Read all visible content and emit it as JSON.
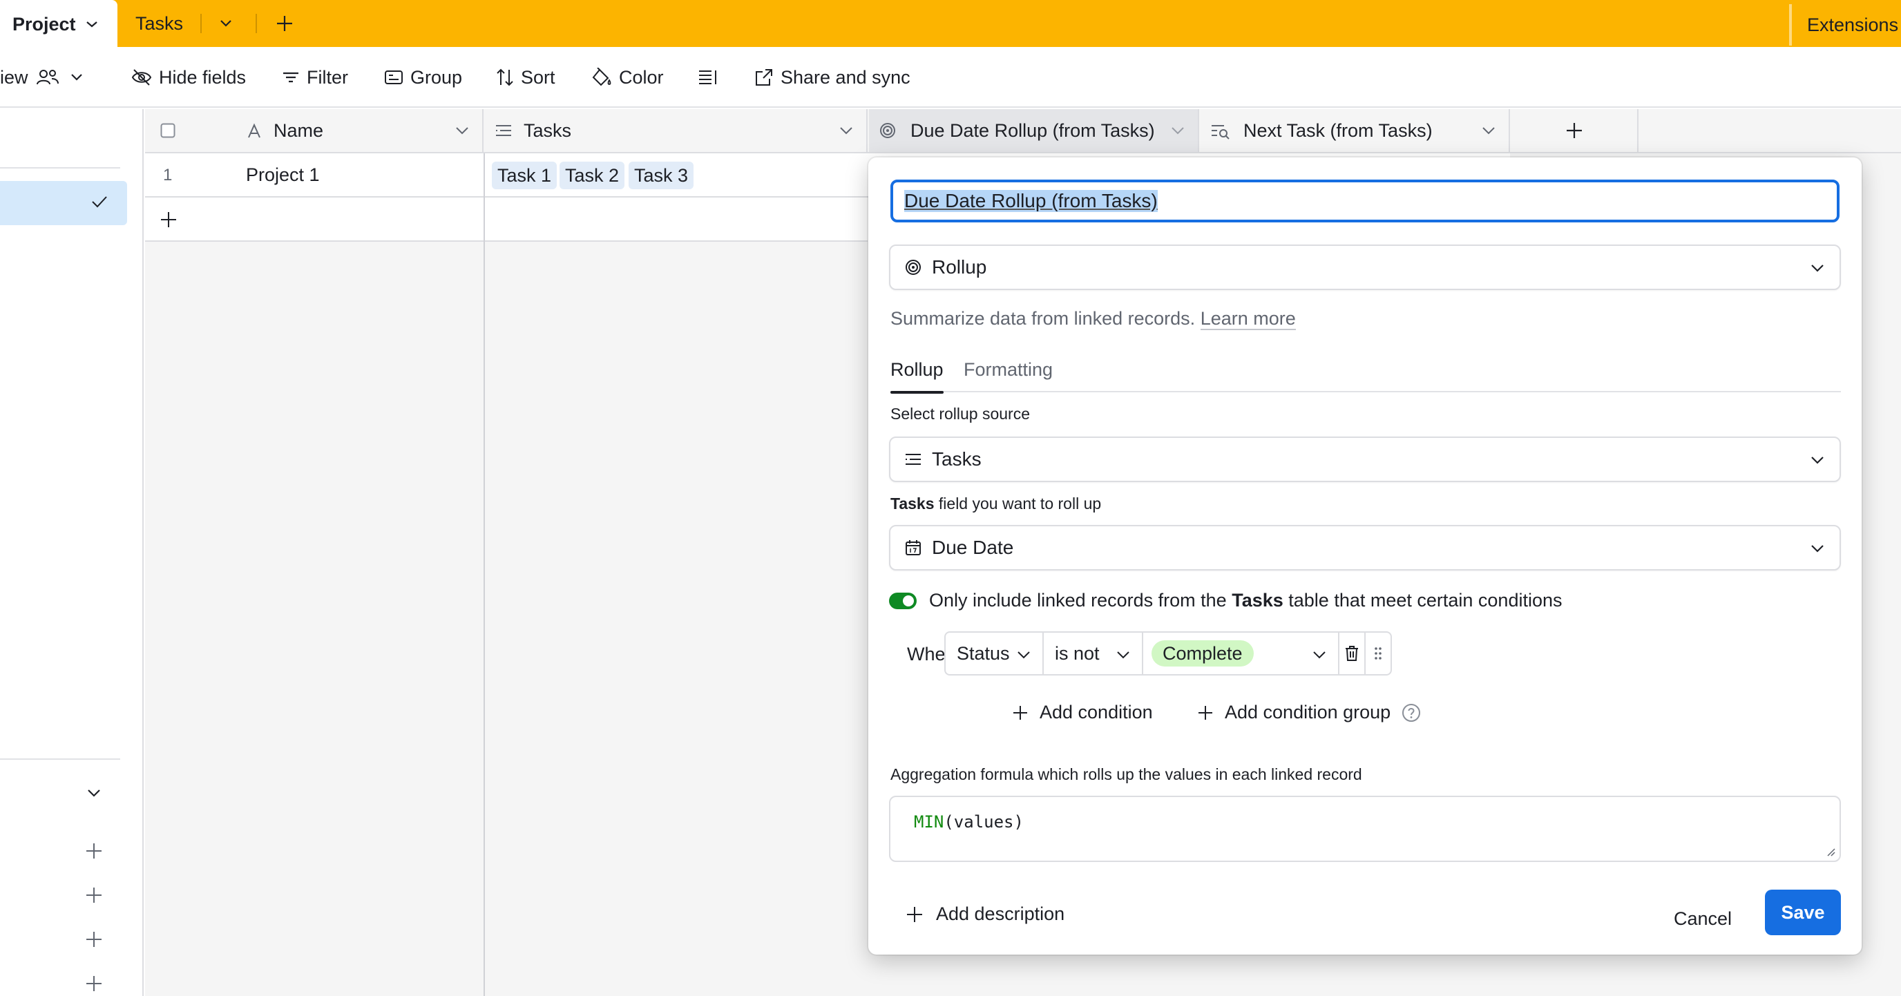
{
  "tabs": {
    "project": "Project",
    "tasks": "Tasks",
    "extensions": "Extensions"
  },
  "toolbar": {
    "view_partial": "iew",
    "hide_fields": "Hide fields",
    "filter": "Filter",
    "group": "Group",
    "sort": "Sort",
    "color": "Color",
    "share_sync": "Share and sync"
  },
  "columns": {
    "name": "Name",
    "tasks": "Tasks",
    "rollup": "Due Date Rollup (from Tasks)",
    "next_task": "Next Task (from Tasks)"
  },
  "rows": [
    {
      "num": "1",
      "name": "Project 1",
      "tasks": [
        "Task 1",
        "Task 2",
        "Task 3"
      ]
    }
  ],
  "editor": {
    "field_name": "Due Date Rollup (from Tasks)",
    "field_type": "Rollup",
    "help_text": "Summarize data from linked records.",
    "learn_more": "Learn more",
    "tab_rollup": "Rollup",
    "tab_formatting": "Formatting",
    "source_label": "Select rollup source",
    "source_value": "Tasks",
    "field_label_bold": "Tasks",
    "field_label_rest": " field you want to roll up",
    "field_value": "Due Date",
    "condition_toggle_pre": "Only include linked records from the ",
    "condition_toggle_bold": "Tasks",
    "condition_toggle_post": " table that meet certain conditions",
    "where": "Where",
    "cond_field": "Status",
    "cond_op": "is not",
    "cond_value": "Complete",
    "add_condition": "Add condition",
    "add_condition_group": "Add condition group",
    "aggregation_label": "Aggregation formula which rolls up the values in each linked record",
    "formula_fn": "MIN",
    "formula_args": "(values)",
    "add_description": "Add description",
    "cancel": "Cancel",
    "save": "Save"
  },
  "colors": {
    "tabbar": "#fcb400",
    "accent": "#166ee1",
    "pill": "#d1f7c4",
    "toggle_on": "#0f8a24"
  }
}
